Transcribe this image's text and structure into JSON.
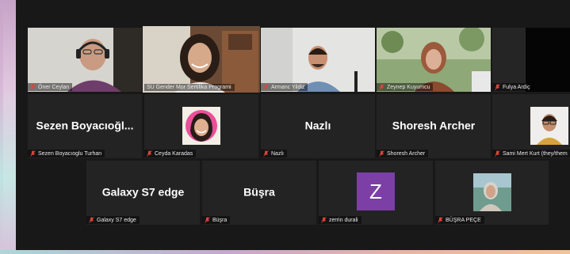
{
  "participants_row1": [
    {
      "id": "oner",
      "name": "Öner Ceylan",
      "muted": true
    },
    {
      "id": "su",
      "name": "SU Gender Mor Sertifika Programi",
      "muted": false,
      "active": true
    },
    {
      "id": "armanc",
      "name": "Armanc Yildiz",
      "muted": true
    },
    {
      "id": "zeynep",
      "name": "Zeynep Kuyumcu",
      "muted": true
    },
    {
      "id": "fulya",
      "name": "Fulya Ardiç",
      "muted": true
    }
  ],
  "participants_row2": [
    {
      "id": "sezen",
      "display": "Sezen  Boyacıoğl...",
      "name": "Sezen Boyacıoglu Turhan",
      "muted": true
    },
    {
      "id": "ceyda",
      "name": "Ceyda Karadas",
      "muted": true
    },
    {
      "id": "nazli",
      "display": "Nazlı",
      "name": "Nazlı",
      "muted": true
    },
    {
      "id": "shoresh",
      "display": "Shoresh Archer",
      "name": "Shoresh Archer",
      "muted": true
    },
    {
      "id": "sami",
      "name": "Sami Mert Kurt (they/them",
      "muted": true
    }
  ],
  "participants_row3": [
    {
      "id": "galaxy",
      "display": "Galaxy S7 edge",
      "name": "Galaxy S7 edge",
      "muted": true
    },
    {
      "id": "busra",
      "display": "Büşra",
      "name": "Büşra",
      "muted": true
    },
    {
      "id": "zerrin",
      "avatar_letter": "Z",
      "name": "zerrin durali",
      "muted": true
    },
    {
      "id": "busrapece",
      "name": "BÜŞRA PEÇE",
      "muted": true
    }
  ],
  "colors": {
    "active_border": "#e2d44a",
    "mute_icon": "#e0443a",
    "zerrin_avatar": "#7b3fa6"
  }
}
